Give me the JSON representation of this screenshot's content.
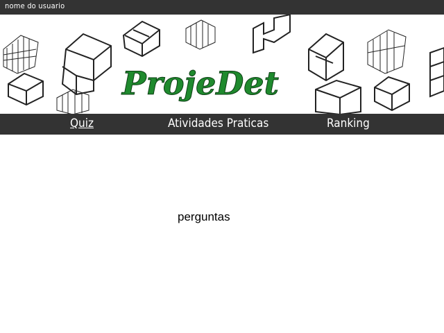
{
  "user": {
    "name": "nome do usuario"
  },
  "banner": {
    "logo_text": "ProjeDet"
  },
  "nav": {
    "items": [
      {
        "label": "Quiz",
        "active": true
      },
      {
        "label": "Atividades Praticas",
        "active": false
      },
      {
        "label": "Ranking",
        "active": false
      }
    ]
  },
  "main": {
    "text": "perguntas"
  },
  "colors": {
    "bar": "#333333",
    "logo_green": "#1f8a2e",
    "background": "#ffffff"
  }
}
